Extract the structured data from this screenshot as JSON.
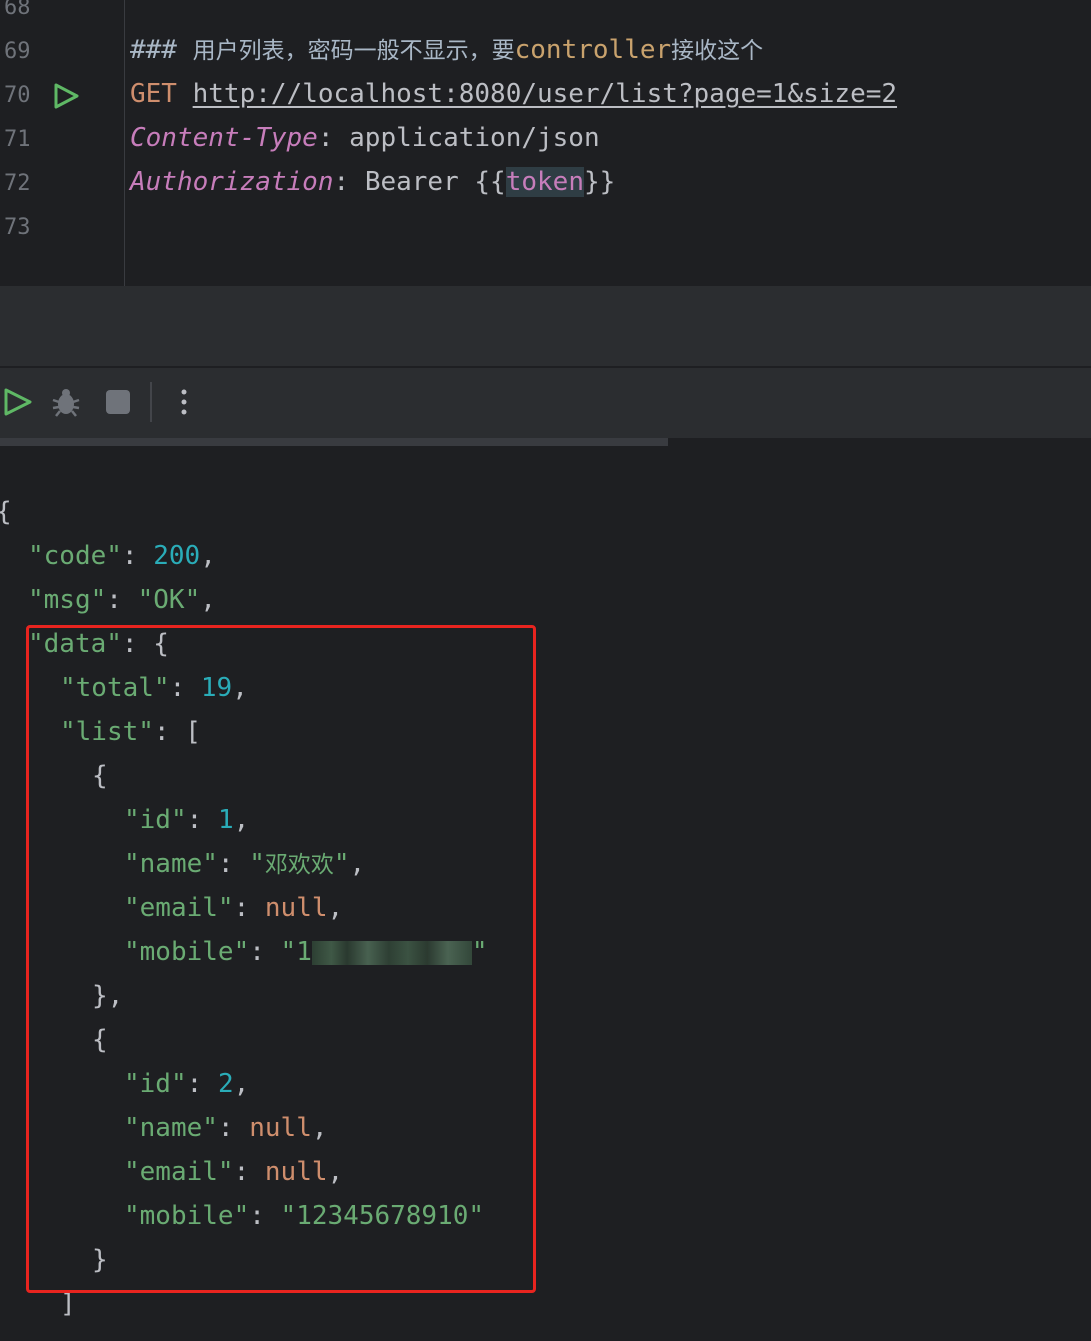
{
  "editor": {
    "lines": [
      {
        "num": "68"
      },
      {
        "num": "69",
        "comment_hash": "### ",
        "comment_cjk_a": "用户列表，密码一般不显示，要",
        "comment_word": "controller",
        "comment_cjk_b": "接收这个"
      },
      {
        "num": "70",
        "method": "GET",
        "url": "http://localhost:8080/user/list?page=1&size=2"
      },
      {
        "num": "71",
        "header_name": "Content-Type",
        "header_value": "application/json"
      },
      {
        "num": "72",
        "header_name": "Authorization",
        "header_value_prefix": "Bearer ",
        "var_open": "{{",
        "var_name": "token",
        "var_close": "}}"
      },
      {
        "num": "73"
      }
    ]
  },
  "toolbar": {
    "run": "run-icon",
    "debug": "bug-icon",
    "stop": "stop-icon",
    "more": "more-vertical-icon"
  },
  "response": {
    "code": 200,
    "msg": "OK",
    "total": 19,
    "list": [
      {
        "id": 1,
        "name": "邓欢欢",
        "email": "null",
        "mobile_visible_prefix": "1"
      },
      {
        "id": 2,
        "name": "null",
        "email": "null",
        "mobile": "12345678910"
      }
    ]
  },
  "colors": {
    "highlight_box": "#e8241f",
    "background": "#1e1f22"
  }
}
